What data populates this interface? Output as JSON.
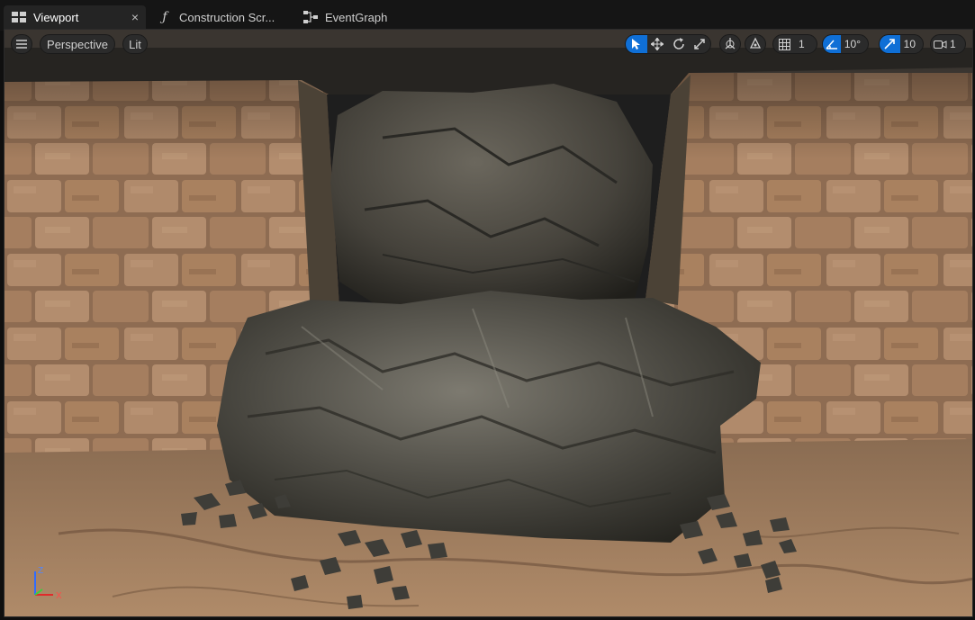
{
  "tabs": [
    {
      "label": "Viewport",
      "icon": "viewport-grid-icon",
      "active": true
    },
    {
      "label": "Construction Scr...",
      "icon": "function-icon",
      "active": false
    },
    {
      "label": "EventGraph",
      "icon": "event-graph-icon",
      "active": false
    }
  ],
  "tab_close_glyph": "×",
  "viewport_toolbar": {
    "view_mode": "Perspective",
    "lighting": "Lit",
    "grid_snap": "1",
    "rotation_snap": "10°",
    "scale_snap": "10",
    "camera_speed": "1"
  },
  "axis_labels": {
    "z": "Z",
    "x": "X"
  },
  "colors": {
    "accent": "#0f6fd6",
    "tab_bg": "#151515",
    "active_tab_bg": "#242424"
  }
}
